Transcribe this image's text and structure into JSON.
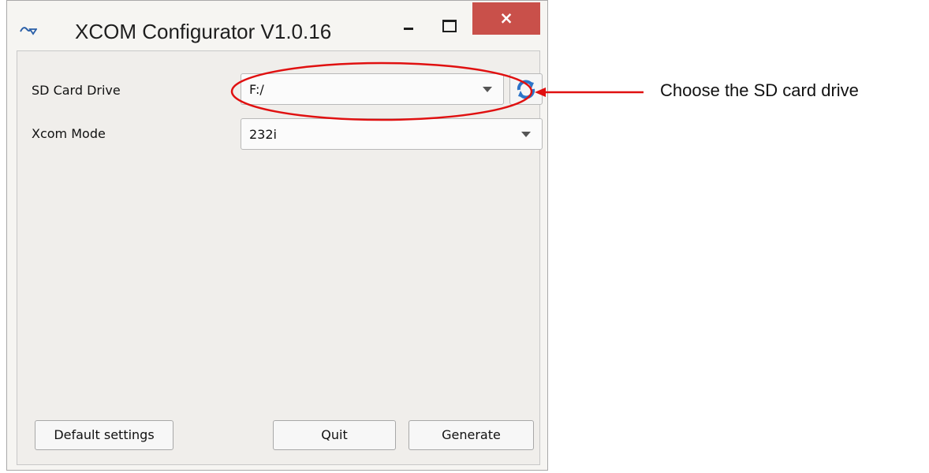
{
  "window": {
    "title": "XCOM Configurator V1.0.16",
    "close_glyph": "×",
    "app_icon": "app-logo-icon",
    "accent_close": "#c9504a"
  },
  "form": {
    "sd_card_drive": {
      "label": "SD Card Drive",
      "value": "F:/"
    },
    "xcom_mode": {
      "label": "Xcom Mode",
      "value": "232i"
    },
    "refresh_icon": "refresh-icon"
  },
  "buttons": {
    "default_settings": "Default settings",
    "quit": "Quit",
    "generate": "Generate"
  },
  "annotation": {
    "text": "Choose the SD card drive",
    "color": "#e01010"
  }
}
